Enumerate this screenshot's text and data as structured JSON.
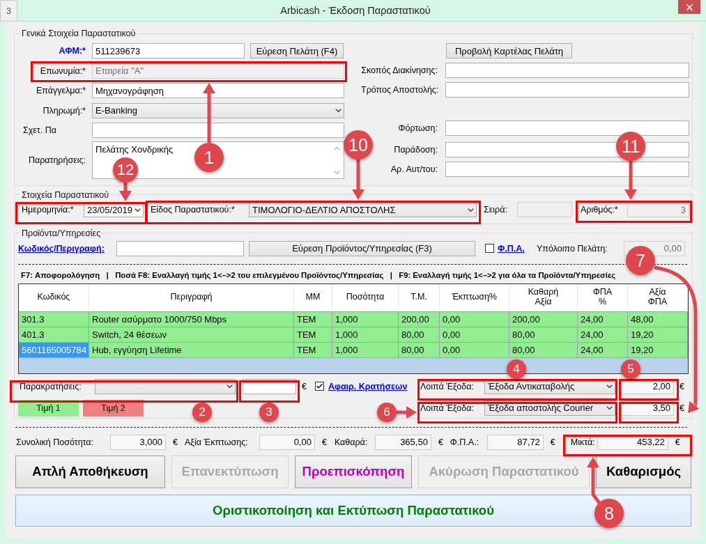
{
  "left_tab": {
    "label": "3"
  },
  "window": {
    "title": "Arbicash - Έκδοση Παραστατικού"
  },
  "general": {
    "legend": "Γενικά Στοιχεία Παραστατικού",
    "afm": {
      "label": "ΑΦΜ:*",
      "value": "511239673"
    },
    "find_customer_button": "Εύρεση Πελάτη (F4)",
    "view_card_button": "Προβολή Καρτέλας Πελάτη",
    "left_fields": [
      {
        "label": "Επωνυμία:*",
        "value": "Εταιρεία \"A\"",
        "kind": "text",
        "disabled": true
      },
      {
        "label": "Επάγγελμα:*",
        "value": "Μηχανογράφηση",
        "kind": "text",
        "disabled": false
      },
      {
        "label": "Πληρωμή:*",
        "value": "E-Banking",
        "kind": "select",
        "disabled": false
      },
      {
        "label": "Σχετ. Πα",
        "kind": "text",
        "disabled": false
      },
      {
        "label": "Παρατηρήσεις:",
        "value": "Πελάτης Χονδρικής",
        "kind": "textarea",
        "disabled": false
      }
    ],
    "right_fields": [
      {
        "label": "Σκοπός Διακίνησης:"
      },
      {
        "label": "Τρόπος Αποστολής:"
      },
      {
        "label": "Φόρτωση:"
      },
      {
        "label": "Παράδοση:"
      },
      {
        "label": "Αρ. Αυτ/του:"
      }
    ]
  },
  "document": {
    "legend": "Στοιχεία Παραστατικού",
    "date": {
      "label": "Ημερομηνία:*",
      "value": "23/05/2019"
    },
    "type": {
      "label": "Είδος Παραστατικού:*",
      "value": "ΤΙΜΟΛΟΓΙΟ-ΔΕΛΤΙΟ ΑΠΟΣΤΟΛΗΣ"
    },
    "series": {
      "label": "Σειρά:"
    },
    "number": {
      "label": "Αριθμός:*",
      "value": "3"
    }
  },
  "products": {
    "legend": "Προϊόντα/Υπηρεσίες",
    "code_link": "Κωδικός/Περιγραφή:",
    "find_button": "Εύρεση Προϊόντος/Υπηρεσίας (F3)",
    "vat_checkbox": {
      "label": "Φ.Π.Α.",
      "checked": false
    },
    "balance": {
      "label": "Υπόλοιπο Πελάτη:",
      "value": "0,00"
    },
    "shortcuts": "F7: Αποφορολόγηση   |   Ποσά F8: Εναλλαγή τιμής 1<–>2 του επιλεγμένου Προϊόντος/Υπηρεσίας   |   F9: Εναλλαγή τιμής 1<–>2 για όλα τα Προϊόντα/Υπηρεσίες",
    "table": {
      "columns": [
        "Κωδικός",
        "Περιγραφή",
        "ΜΜ",
        "Ποσότητα",
        "Τ.Μ.",
        "Έκπτωση%",
        "Καθαρή\nΑξία",
        "ΦΠΑ\n%",
        "Αξία\nΦΠΑ"
      ],
      "rows": [
        {
          "cells": [
            "301.3",
            "Router ασύρματο 1000/750 Mbps",
            "TEM",
            "1,000",
            "200,00",
            "0,00",
            "200,00",
            "24,00",
            "48,00"
          ],
          "kind": "price_1",
          "selected": false
        },
        {
          "cells": [
            "401.3",
            "Switch, 24 θέσεων",
            "TEM",
            "1,000",
            "80,00",
            "0,00",
            "80,00",
            "24,00",
            "19,20"
          ],
          "kind": "price_1",
          "selected": false
        },
        {
          "cells": [
            "5601165005784",
            "Hub, εγγύηση Lifetime",
            "TEM",
            "1,000",
            "80,00",
            "0,00",
            "80,00",
            "24,00",
            "19,20"
          ],
          "kind": "price_1",
          "selected": true
        }
      ]
    },
    "withholding": {
      "label": "Παρακρατήσεις:",
      "currency": "€"
    },
    "deduct_checkbox": {
      "label": "Αφαιρ. Κρατήσεων",
      "checked": true
    },
    "price_legend": [
      {
        "label": "Τιμή 1",
        "color": "#90ee90"
      },
      {
        "label": "Τιμή 2",
        "color": "#f08080"
      }
    ],
    "other_charges": [
      {
        "label": "Λοιπά Έξοδα:",
        "value": "Έξοδα Αντικαταβολής",
        "amount": "2,00",
        "currency": "€"
      },
      {
        "label": "Λοιπά Έξοδα:",
        "value": "Έξοδα αποστολής Courier",
        "amount": "3,50",
        "currency": "€"
      }
    ]
  },
  "totals": [
    {
      "label": "Συνολική Ποσότητα:",
      "value": "3,000",
      "currency": "€"
    },
    {
      "label": "Αξία Έκπτωσης:",
      "value": "0,00",
      "currency": "€"
    },
    {
      "label": "Καθαρά:",
      "value": "365,50",
      "currency": "€"
    },
    {
      "label": "Φ.Π.Α.:",
      "value": "87,72",
      "currency": "€"
    },
    {
      "label": "Μικτά:",
      "value": "453,22",
      "currency": "€"
    }
  ],
  "actions": [
    {
      "label": "Απλή Αποθήκευση",
      "disabled": false
    },
    {
      "label": "Επανεκτύπωση",
      "disabled": true
    },
    {
      "label": "Προεπισκόπηση",
      "disabled": false,
      "color": "#c000c0"
    },
    {
      "label": "Ακύρωση Παραστατικού",
      "disabled": true
    },
    {
      "label": "Καθαρισμός",
      "disabled": false
    }
  ],
  "finalize_button": {
    "label": "Οριστικοποίηση και Εκτύπωση Παραστατικού"
  },
  "callouts": [
    {
      "number": "1"
    },
    {
      "number": "12"
    },
    {
      "number": "10"
    },
    {
      "number": "11"
    },
    {
      "number": "7"
    },
    {
      "number": "4"
    },
    {
      "number": "5"
    },
    {
      "number": "2"
    },
    {
      "number": "3"
    },
    {
      "number": "6"
    },
    {
      "number": "8"
    }
  ]
}
